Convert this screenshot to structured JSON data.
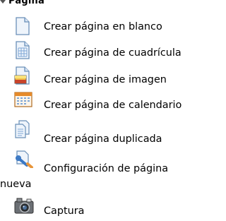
{
  "section": {
    "title": "Página",
    "items": [
      {
        "label": "Crear página en blanco",
        "icon": "blank-page-icon"
      },
      {
        "label": "Crear página de cuadrícula",
        "icon": "grid-page-icon"
      },
      {
        "label": "Crear página de imagen",
        "icon": "image-page-icon"
      },
      {
        "label": "Crear página de calendario",
        "icon": "calendar-page-icon"
      },
      {
        "label": "Crear página duplicada",
        "icon": "duplicate-page-icon"
      },
      {
        "label_line1": "Configuración de página",
        "label_line2": "nueva",
        "icon": "page-settings-icon"
      },
      {
        "label": "Captura",
        "icon": "camera-icon"
      }
    ]
  },
  "colors": {
    "page_outline": "#6a8fb8",
    "page_fill": "#eef4fb",
    "grid_lines": "#7ea6d6",
    "calendar_orange": "#e58a2a",
    "wrench_blue": "#3b78c4",
    "wrench_orange": "#e8953a"
  }
}
